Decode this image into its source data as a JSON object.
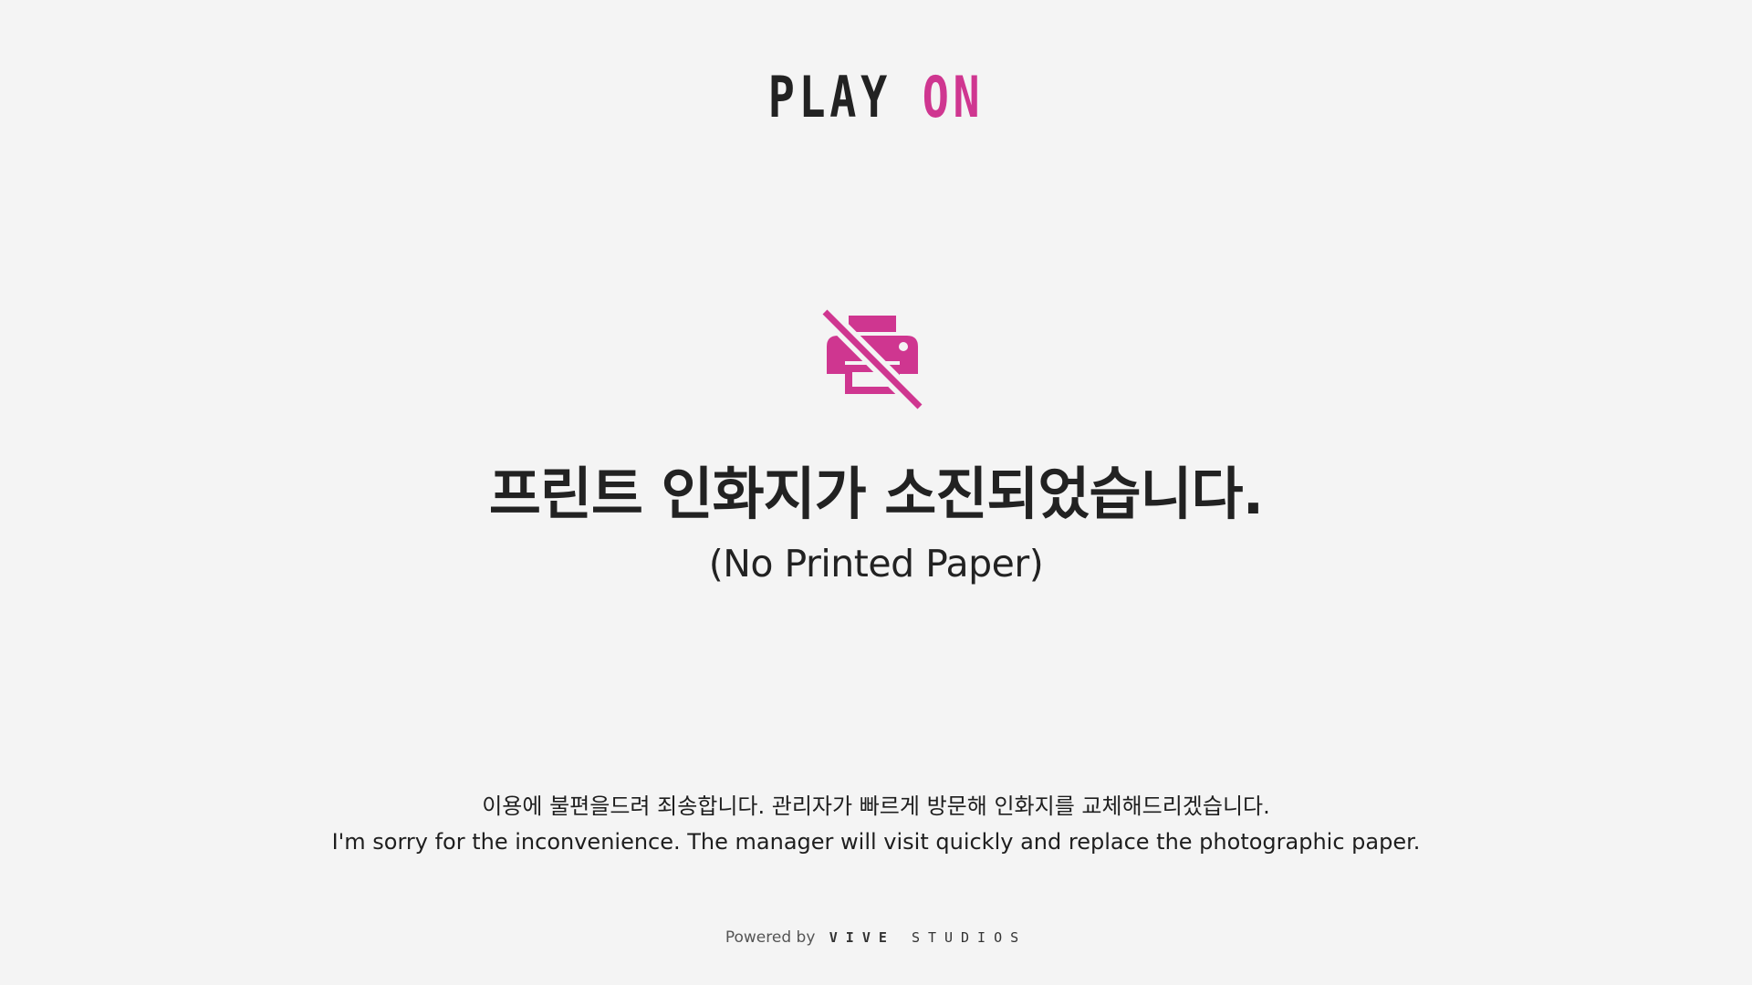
{
  "logo": {
    "part1": "PLAY",
    "part2": "ON",
    "accent_color": "#cf3690"
  },
  "icon": {
    "name": "printer-off-icon",
    "color": "#cf3690"
  },
  "title": "프린트 인화지가 소진되었습니다.",
  "subtitle": "(No Printed Paper)",
  "message": {
    "korean": "이용에 불편을드려 죄송합니다. 관리자가 빠르게 방문해 인화지를 교체해드리겠습니다.",
    "english": "I'm sorry for the inconvenience. The manager will visit quickly and replace the photographic paper."
  },
  "footer": {
    "powered_by": "Powered by",
    "brand_part1": "VIVE",
    "brand_part2": "STUDIOS"
  }
}
